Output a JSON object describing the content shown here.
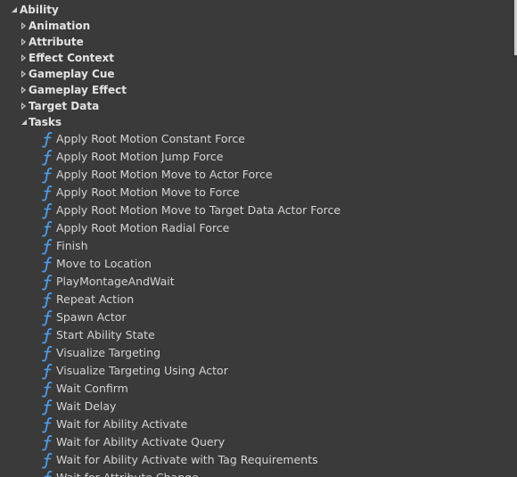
{
  "root": {
    "label": "Ability"
  },
  "categories": [
    {
      "label": "Animation"
    },
    {
      "label": "Attribute"
    },
    {
      "label": "Effect Context"
    },
    {
      "label": "Gameplay Cue"
    },
    {
      "label": "Gameplay Effect"
    },
    {
      "label": "Target Data"
    }
  ],
  "tasks": {
    "label": "Tasks",
    "items": [
      {
        "label": "Apply Root Motion Constant Force"
      },
      {
        "label": "Apply Root Motion Jump Force"
      },
      {
        "label": "Apply Root Motion Move to Actor Force"
      },
      {
        "label": "Apply Root Motion Move to Force"
      },
      {
        "label": "Apply Root Motion Move to Target Data Actor Force"
      },
      {
        "label": "Apply Root Motion Radial Force"
      },
      {
        "label": "Finish"
      },
      {
        "label": "Move to Location"
      },
      {
        "label": "PlayMontageAndWait"
      },
      {
        "label": "Repeat Action"
      },
      {
        "label": "Spawn Actor"
      },
      {
        "label": "Start Ability State"
      },
      {
        "label": "Visualize Targeting"
      },
      {
        "label": "Visualize Targeting Using Actor"
      },
      {
        "label": "Wait Confirm"
      },
      {
        "label": "Wait Delay"
      },
      {
        "label": "Wait for Ability Activate"
      },
      {
        "label": "Wait for Ability Activate Query"
      },
      {
        "label": "Wait for Ability Activate with Tag Requirements"
      },
      {
        "label": "Wait for Attribute Change"
      }
    ]
  },
  "colors": {
    "background": "#3a3a3a",
    "text": "#dcdcdc",
    "function_icon": "#4f9be8"
  },
  "icons": {
    "expanded": "triangle-down-icon",
    "collapsed": "triangle-right-icon",
    "function": "function-f-icon"
  }
}
